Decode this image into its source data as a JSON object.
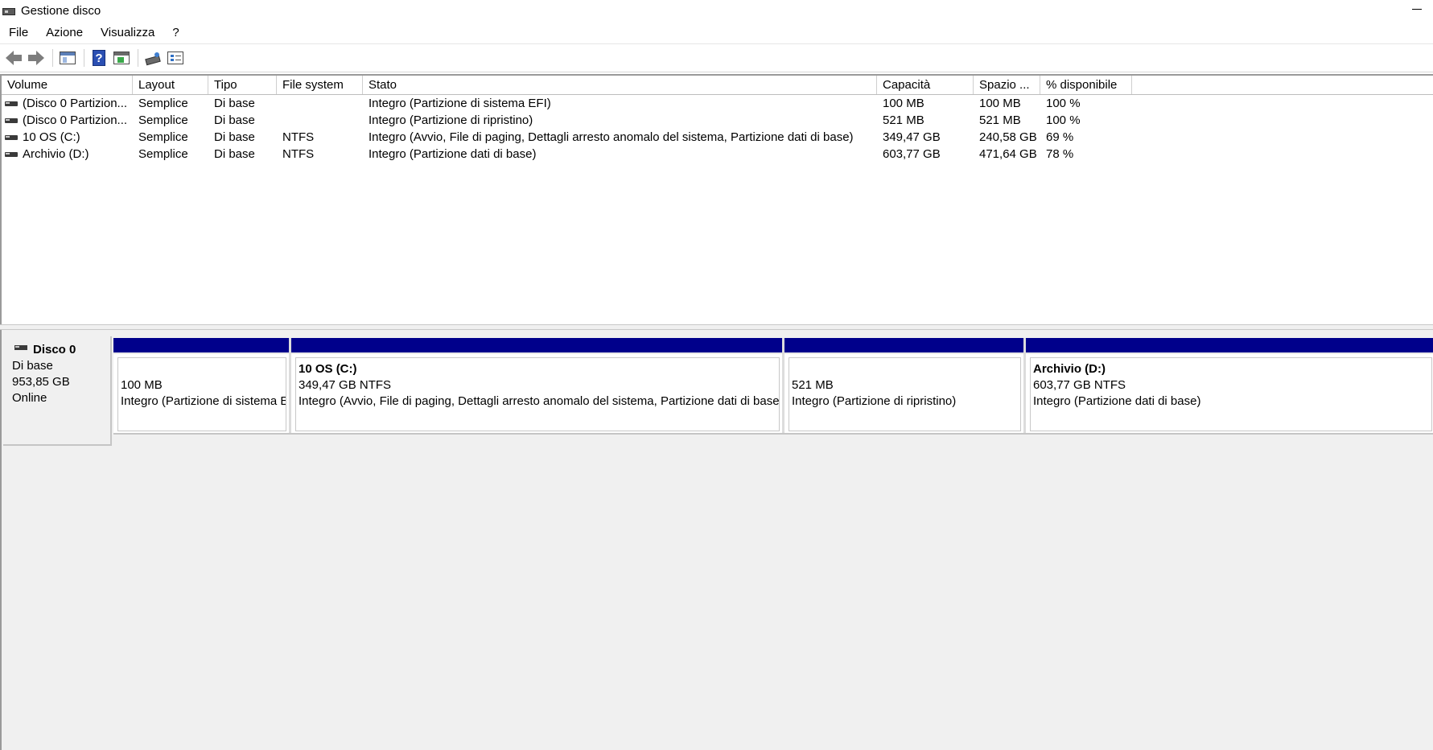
{
  "window": {
    "title": "Gestione disco"
  },
  "menu": [
    "File",
    "Azione",
    "Visualizza",
    "?"
  ],
  "toolbar": {
    "buttons": [
      "back-icon",
      "forward-icon",
      "show-hide-console-tree-icon",
      "help-icon",
      "properties-icon",
      "connect-icon",
      "list-view-icon"
    ]
  },
  "volume_table": {
    "columns": [
      "Volume",
      "Layout",
      "Tipo",
      "File system",
      "Stato",
      "Capacità",
      "Spazio ...",
      "% disponibile"
    ],
    "rows": [
      {
        "volume": "(Disco 0 Partizion...",
        "layout": "Semplice",
        "tipo": "Di base",
        "fs": "",
        "stato": "Integro (Partizione di sistema EFI)",
        "capacita": "100 MB",
        "spazio": "100 MB",
        "disponibile": "100 %"
      },
      {
        "volume": "(Disco 0 Partizion...",
        "layout": "Semplice",
        "tipo": "Di base",
        "fs": "",
        "stato": "Integro (Partizione di ripristino)",
        "capacita": "521 MB",
        "spazio": "521 MB",
        "disponibile": "100 %"
      },
      {
        "volume": "10 OS (C:)",
        "layout": "Semplice",
        "tipo": "Di base",
        "fs": "NTFS",
        "stato": "Integro (Avvio, File di paging, Dettagli arresto anomalo del sistema, Partizione dati di base)",
        "capacita": "349,47 GB",
        "spazio": "240,58 GB",
        "disponibile": "69 %"
      },
      {
        "volume": "Archivio (D:)",
        "layout": "Semplice",
        "tipo": "Di base",
        "fs": "NTFS",
        "stato": "Integro (Partizione dati di base)",
        "capacita": "603,77 GB",
        "spazio": "471,64 GB",
        "disponibile": "78 %"
      }
    ]
  },
  "disk": {
    "name": "Disco 0",
    "type": "Di base",
    "size": "953,85 GB",
    "status": "Online",
    "partitions": [
      {
        "name": "",
        "size": "100 MB",
        "status": "Integro (Partizione di sistema EFI)"
      },
      {
        "name": "10 OS  (C:)",
        "size": "349,47 GB NTFS",
        "status": "Integro (Avvio, File di paging, Dettagli arresto anomalo del sistema, Partizione dati di base)"
      },
      {
        "name": "",
        "size": "521 MB",
        "status": "Integro (Partizione di ripristino)"
      },
      {
        "name": "Archivio  (D:)",
        "size": "603,77 GB NTFS",
        "status": "Integro (Partizione dati di base)"
      }
    ]
  },
  "colors": {
    "partition_bar": "#00008b",
    "graph_background": "#f0f0f0"
  }
}
